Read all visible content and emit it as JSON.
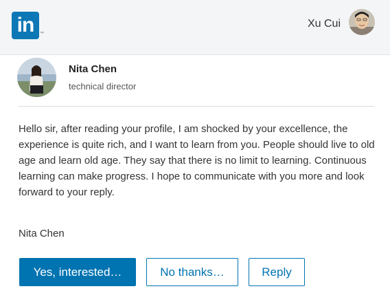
{
  "header": {
    "logo_text": "in",
    "logo_tm": "™",
    "user_name": "Xu Cui",
    "brand_color": "#0e77b5"
  },
  "sender": {
    "name": "Nita Chen",
    "title": "technical director"
  },
  "message": {
    "body": "Hello sir, after reading your profile, I am shocked by your excellence, the experience is quite rich, and I want to learn from you. People should live to old age and learn old age. They say that there is no limit to learning. Continuous learning can make progress. I hope to communicate with you more and look forward to your reply.",
    "signature": "Nita Chen"
  },
  "actions": {
    "interested_label": "Yes, interested…",
    "no_thanks_label": "No thanks…",
    "reply_label": "Reply",
    "accent_color": "#0073b1"
  }
}
